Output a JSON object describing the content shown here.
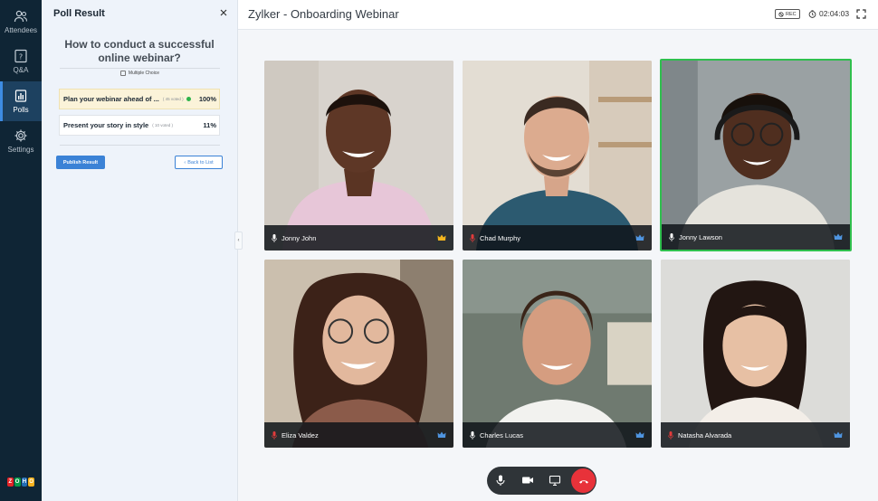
{
  "nav": {
    "items": [
      {
        "label": "Attendees",
        "icon": "people-icon"
      },
      {
        "label": "Q&A",
        "icon": "question-icon"
      },
      {
        "label": "Polls",
        "icon": "poll-chart-icon",
        "active": true
      },
      {
        "label": "Settings",
        "icon": "gear-icon"
      }
    ],
    "logo_letters": [
      "Z",
      "O",
      "H",
      "O"
    ],
    "logo_colors": [
      "#e42527",
      "#089949",
      "#226db4",
      "#f9b21d"
    ]
  },
  "poll_panel": {
    "header": "Poll Result",
    "question": "How to conduct a successful online webinar?",
    "type_label": "Multiple Choice",
    "options": [
      {
        "label": "Plan your webinar ahead of ...",
        "votes": "( 45 voted )",
        "percent": "100%",
        "winner": true
      },
      {
        "label": "Present your story in style",
        "votes": "( 10 voted )",
        "percent": "11%",
        "winner": false
      }
    ],
    "publish_label": "Publish Result",
    "back_label": "Back to List"
  },
  "topbar": {
    "title": "Zylker - Onboarding Webinar",
    "rec_label": "REC",
    "timer": "02:04:03"
  },
  "participants": [
    {
      "name": "Jonny John",
      "mic": "on",
      "role": "host-crown-icon",
      "speaking": false
    },
    {
      "name": "Chad Murphy",
      "mic": "muted",
      "role": "cohost-icon",
      "speaking": false
    },
    {
      "name": "Jonny Lawson",
      "mic": "on",
      "role": "cohost-icon",
      "speaking": true
    },
    {
      "name": "Eliza Valdez",
      "mic": "muted",
      "role": "cohost-icon",
      "speaking": false
    },
    {
      "name": "Charles Lucas",
      "mic": "on",
      "role": "cohost-icon",
      "speaking": false
    },
    {
      "name": "Natasha Alvarada",
      "mic": "muted",
      "role": "cohost-icon",
      "speaking": false
    }
  ],
  "colors": {
    "rail_bg": "#0f2535",
    "accent": "#3b82d6",
    "speaking_border": "#2fbf4e",
    "end_call": "#e8323a",
    "muted_mic": "#e23b3b"
  }
}
